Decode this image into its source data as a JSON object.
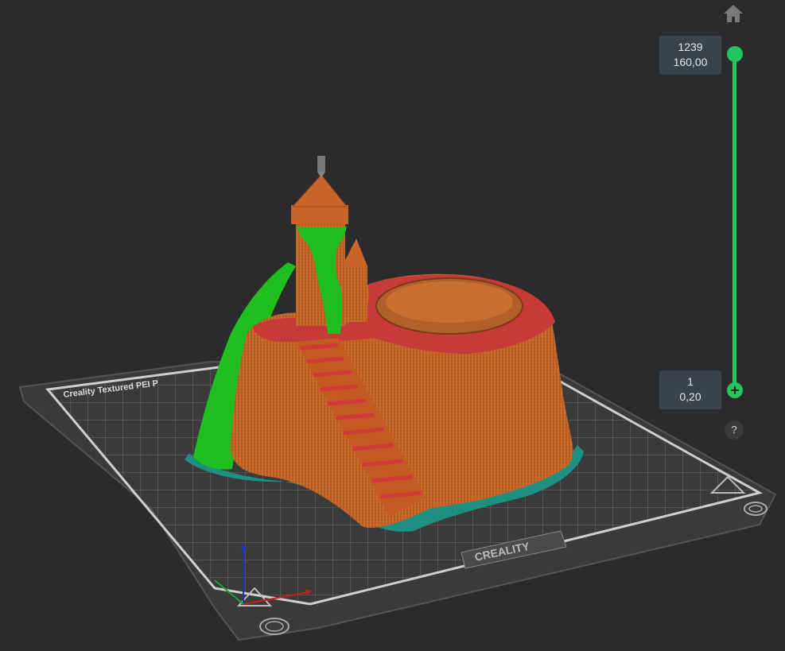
{
  "toolbar": {
    "home_icon": "home-icon"
  },
  "layer_slider": {
    "top_layer": "1239",
    "top_height": "160,00",
    "bottom_layer": "1",
    "bottom_height": "0,20",
    "accent_color": "#22c55e"
  },
  "help": {
    "label": "?"
  },
  "build_plate": {
    "plate_label": "Creality Textured PEI P",
    "brand_logo": "CREALITY",
    "corner_marks": [
      "fingerprint-icon",
      "warning-triangle-icon"
    ]
  },
  "model": {
    "colors": {
      "wall": "#c8662a",
      "wall_dark": "#a9521e",
      "top_surface": "#c73a3a",
      "support": "#1fbf1f",
      "skirt": "#1b9a8a"
    }
  }
}
